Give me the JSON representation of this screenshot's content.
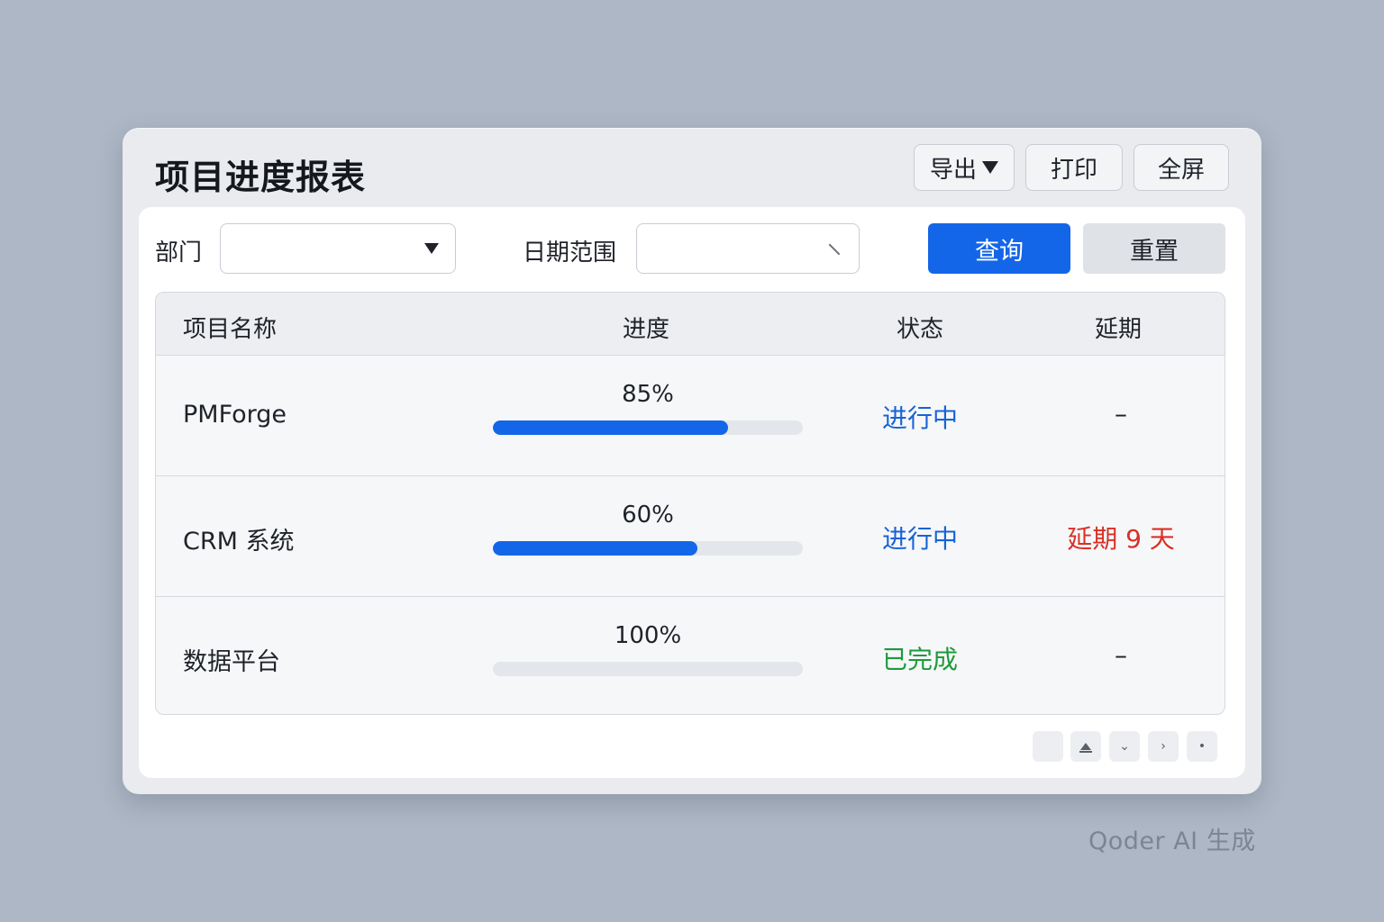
{
  "window": {
    "title": "项目进度报表"
  },
  "toolbar": {
    "export_label": "导出",
    "print_label": "打印",
    "fullscreen_label": "全屏"
  },
  "filters": {
    "department_label": "部门",
    "department_value": "",
    "date_range_label": "日期范围",
    "date_range_value": "",
    "query_label": "查询",
    "reset_label": "重置"
  },
  "table": {
    "headers": [
      "项目名称",
      "进度",
      "状态",
      "延期"
    ],
    "rows": [
      {
        "name": "PMForge",
        "progress_text": "85%",
        "progress": 0.76,
        "status": "进行中",
        "status_color": "#1763d6",
        "delay": "–",
        "delay_color": "#1f2329"
      },
      {
        "name": "CRM 系统",
        "progress_text": "60%",
        "progress": 0.66,
        "status": "进行中",
        "status_color": "#1763d6",
        "delay": "延期 9 天",
        "delay_color": "#d93026"
      },
      {
        "name": "数据平台",
        "progress_text": "100%",
        "progress": 0,
        "status": "已完成",
        "status_color": "#1e9a3c",
        "delay": "–",
        "delay_color": "#1f2329"
      }
    ]
  },
  "pagination": {
    "icons": [
      "blank",
      "eject-icon",
      "chevron-down-icon",
      "chevron-right-icon",
      "dot-icon"
    ],
    "down_glyph": "⌄",
    "next_glyph": "›",
    "dot_glyph": "•"
  },
  "watermark": "Qoder AI 生成",
  "colors": {
    "accent": "#1466e8",
    "track": "#e3e6ea"
  }
}
